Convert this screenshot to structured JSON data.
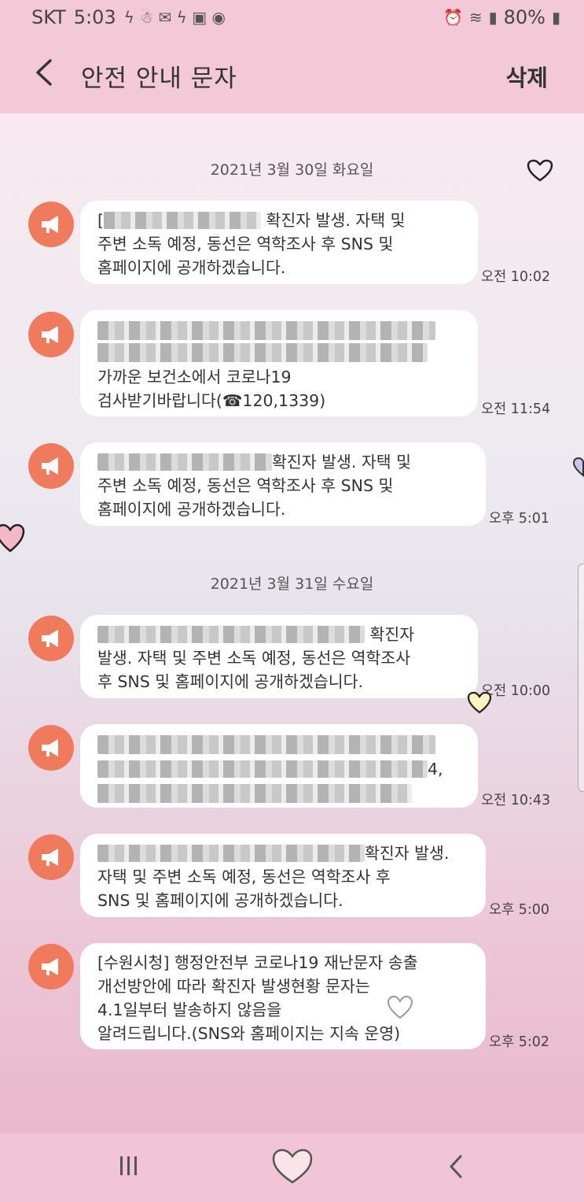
{
  "status_bar": {
    "carrier": "SKT",
    "time": "5:03",
    "battery": "80%"
  },
  "app_bar": {
    "title": "안전 안내 문자",
    "delete_label": "삭제"
  },
  "date_groups": [
    {
      "date": "2021년 3월 30일 화요일"
    },
    {
      "date": "2021년 3월 31일 수요일"
    }
  ],
  "messages": [
    {
      "lines": [
        "[",
        "확진자 발생. 자택 및",
        "주변 소독 예정, 동선은 역학조사 후 SNS 및",
        "홈페이지에 공개하겠습니다."
      ],
      "time": "오전 10:02"
    },
    {
      "lines": [
        "가까운 보건소에서 코로나19",
        "검사받기바랍니다(☎120,1339)"
      ],
      "time": "오전 11:54"
    },
    {
      "lines": [
        "확진자 발생. 자택 및",
        "주변 소독 예정, 동선은 역학조사 후 SNS 및",
        "홈페이지에 공개하겠습니다."
      ],
      "time": "오후 5:01"
    },
    {
      "lines": [
        "확진자",
        "발생. 자택 및 주변 소독 예정, 동선은 역학조사",
        "후 SNS 및 홈페이지에 공개하겠습니다."
      ],
      "time": "오전 10:00"
    },
    {
      "lines": [
        "4,"
      ],
      "time": "오전 10:43"
    },
    {
      "lines": [
        "확진자 발생.",
        "자택 및 주변 소독 예정, 동선은 역학조사 후",
        "SNS 및 홈페이지에 공개하겠습니다."
      ],
      "time": "오후 5:00"
    },
    {
      "lines": [
        "[수원시청] 행정안전부 코로나19 재난문자 송출",
        "개선방안에 따라 확진자 발생현황 문자는",
        "4.1일부터 발송하지 않음을",
        "알려드립니다.(SNS와 홈페이지는 지속 운영)"
      ],
      "time": "오후 5:02"
    }
  ],
  "icons": {
    "message": "megaphone-icon",
    "favorite": "heart-icon",
    "nav_recent": "recent-apps-icon",
    "nav_home": "home-heart-icon",
    "nav_back": "nav-back-icon"
  },
  "colors": {
    "app_bar": "#f3c9d7",
    "megaphone": "#f07a5c",
    "bubble": "#ffffff"
  }
}
